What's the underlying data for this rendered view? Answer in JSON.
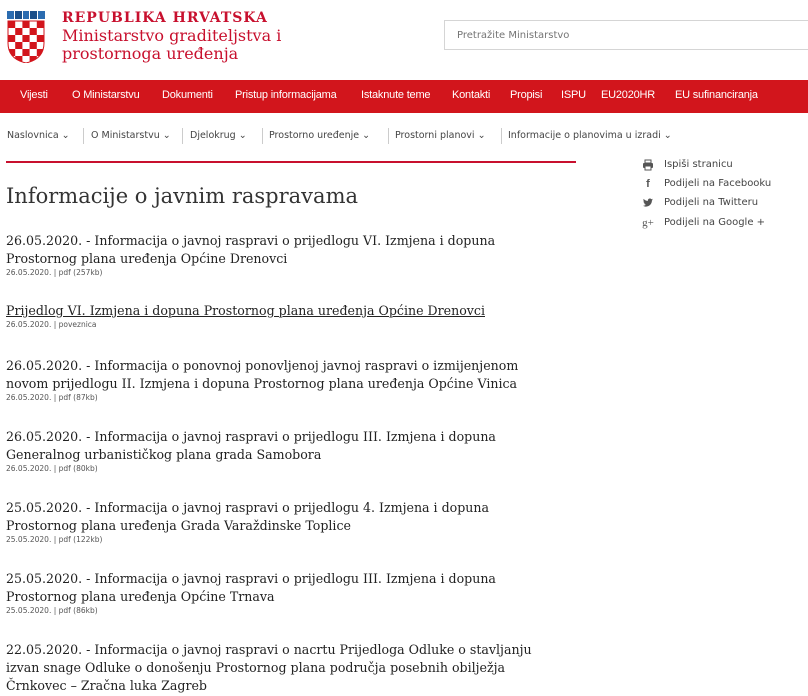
{
  "header": {
    "country": "REPUBLIKA HRVATSKA",
    "ministry_line1": "Ministarstvo graditeljstva i",
    "ministry_line2": "prostornoga uređenja",
    "search_placeholder": "Pretražite Ministarstvo"
  },
  "mainnav": [
    "Vijesti",
    "O Ministarstvu",
    "Dokumenti",
    "Pristup informacijama",
    "Istaknute teme",
    "Kontakti",
    "Propisi",
    "ISPU",
    "EU2020HR",
    "EU sufinanciranja"
  ],
  "breadcrumb": [
    "Naslovnica ⌄",
    "O Ministarstvu ⌄",
    "Djelokrug ⌄",
    "Prostorno uređenje ⌄",
    "Prostorni planovi ⌄",
    "Informacije o planovima u izradi ⌄"
  ],
  "page_title": "Informacije o javnim raspravama",
  "sidebar": {
    "print": "Ispiši stranicu",
    "facebook": "Podijeli na Facebooku",
    "twitter": "Podijeli na Twitteru",
    "google": "Podijeli na Google +"
  },
  "items": [
    {
      "title_l1": "26.05.2020. - Informacija o javnoj raspravi o prijedlogu VI. Izmjena i dopuna",
      "title_l2": "Prostornog plana uređenja Općine Drenovci",
      "title_l3": "",
      "meta": "26.05.2020. | pdf (257kb)"
    },
    {
      "title_l1": "Prijedlog VI. Izmjena i dopuna Prostornog plana uređenja Općine Drenovci",
      "title_l2": "",
      "title_l3": "",
      "meta": "26.05.2020. | poveznica"
    },
    {
      "title_l1": "26.05.2020. - Informacija o ponovnoj ponovljenoj javnoj raspravi o izmijenjenom",
      "title_l2": "novom prijedlogu II. Izmjena i dopuna Prostornog plana uređenja Općine Vinica",
      "title_l3": "",
      "meta": "26.05.2020. | pdf (87kb)"
    },
    {
      "title_l1": "26.05.2020. - Informacija o javnoj raspravi o prijedlogu III. Izmjena i dopuna",
      "title_l2": "Generalnog urbanističkog plana grada Samobora",
      "title_l3": "",
      "meta": "26.05.2020. | pdf (80kb)"
    },
    {
      "title_l1": "25.05.2020. - Informacija o javnoj raspravi o prijedlogu 4. Izmjena i dopuna",
      "title_l2": "Prostornog plana uređenja Grada Varaždinske Toplice",
      "title_l3": "",
      "meta": "25.05.2020. | pdf (122kb)"
    },
    {
      "title_l1": "25.05.2020. - Informacija o javnoj raspravi o prijedlogu III. Izmjena i dopuna",
      "title_l2": "Prostornog plana uređenja Općine Trnava",
      "title_l3": "",
      "meta": "25.05.2020. | pdf (86kb)"
    },
    {
      "title_l1": "22.05.2020. - Informacija o javnoj raspravi o nacrtu Prijedloga Odluke o stavljanju",
      "title_l2": "izvan snage Odluke o donošenju Prostornog plana područja posebnih obilježja",
      "title_l3": "Črnkovec – Zračna luka Zagreb",
      "meta": ""
    }
  ]
}
